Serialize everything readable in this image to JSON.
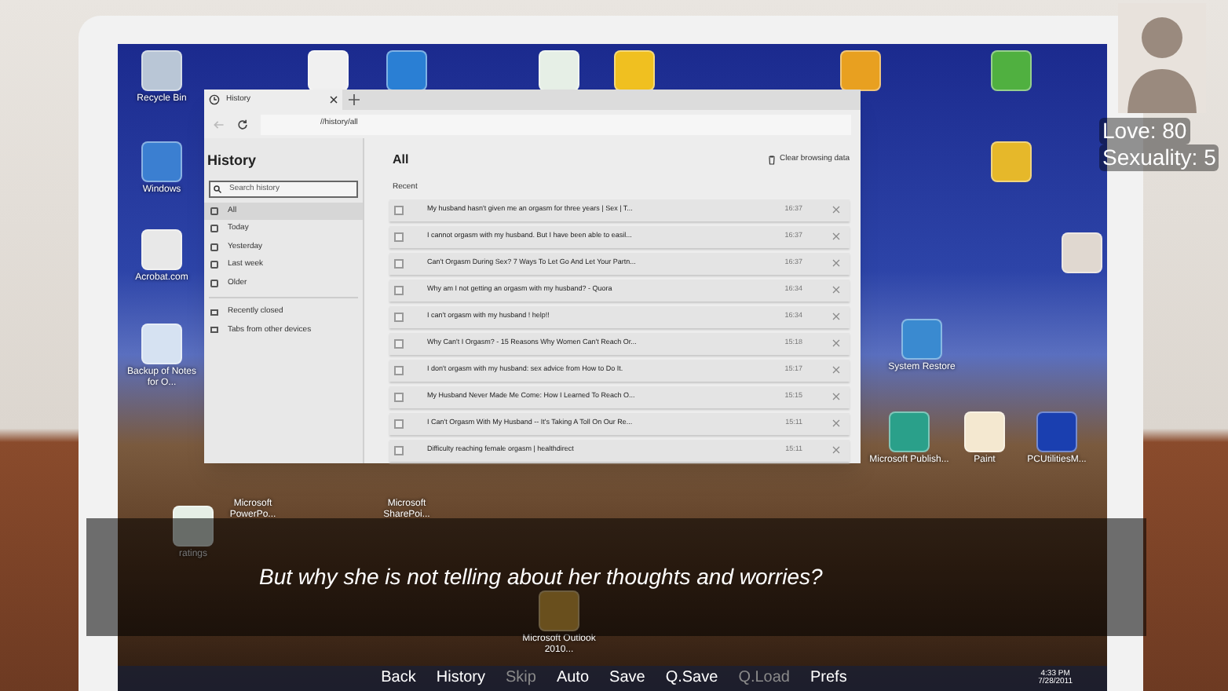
{
  "desktop_icons": [
    {
      "kind": "bin",
      "label": "Recycle Bin"
    },
    {
      "kind": "windows",
      "label": "Windows"
    },
    {
      "kind": "pdf",
      "label": "Acrobat.com"
    },
    {
      "kind": "word",
      "label": "Backup of Notes for O..."
    },
    {
      "kind": "note"
    },
    {
      "kind": "ie"
    },
    {
      "kind": "excel"
    },
    {
      "kind": "wave"
    },
    {
      "kind": "tools"
    },
    {
      "kind": "green"
    },
    {
      "kind": "globe"
    },
    {
      "kind": "person"
    },
    {
      "kind": "restore",
      "label": "System Restore"
    },
    {
      "kind": "publisher",
      "label": "Microsoft Publish..."
    },
    {
      "kind": "paint",
      "label": "Paint"
    },
    {
      "kind": "pcu",
      "label": "PCUtilitiesM..."
    },
    {
      "kind": "hidden",
      "label": "Microsoft PowerPo..."
    },
    {
      "kind": "hidden",
      "label": "Microsoft SharePoi..."
    },
    {
      "kind": "excel",
      "label": "ratings"
    },
    {
      "kind": "outlook",
      "label": "Microsoft Outlook 2010..."
    }
  ],
  "browser": {
    "tab_title": "History",
    "address": "//history/all",
    "sidebar_title": "History",
    "search_placeholder": "Search history",
    "nav": [
      {
        "label": "All",
        "selected": true
      },
      {
        "label": "Today",
        "selected": false
      },
      {
        "label": "Yesterday",
        "selected": false
      },
      {
        "label": "Last week",
        "selected": false
      },
      {
        "label": "Older",
        "selected": false
      }
    ],
    "other": [
      "Recently closed",
      "Tabs from other devices"
    ],
    "heading": "All",
    "clear_button": "Clear browsing data",
    "section": "Recent",
    "entries": [
      {
        "title": "My husband hasn't given me an orgasm for three years | Sex | T...",
        "time": "16:37",
        "checked": false
      },
      {
        "title": "I cannot orgasm with my husband. But I have been able to easil...",
        "time": "16:37",
        "checked": false
      },
      {
        "title": "Can't Orgasm During Sex? 7 Ways To Let Go And Let Your Partn...",
        "time": "16:37",
        "checked": false
      },
      {
        "title": "Why am I not getting an orgasm with my husband? - Quora",
        "time": "16:34",
        "checked": false
      },
      {
        "title": "I can't orgasm with my husband ! help!!",
        "time": "16:34",
        "checked": false
      },
      {
        "title": "Why Can't I Orgasm? - 15 Reasons Why Women Can't Reach Or...",
        "time": "15:18",
        "checked": false
      },
      {
        "title": "I don't orgasm with my husband: sex advice from How to Do It.",
        "time": "15:17",
        "checked": false
      },
      {
        "title": "My Husband Never Made Me Come: How I Learned To Reach O...",
        "time": "15:15",
        "checked": false
      },
      {
        "title": "I Can't Orgasm With My Husband -- It's Taking A Toll On Our Re...",
        "time": "15:11",
        "checked": false
      },
      {
        "title": "Difficulty reaching female orgasm | healthdirect",
        "time": "15:11",
        "checked": false
      }
    ]
  },
  "taskbar": {
    "time": "4:33 PM",
    "date": "7/28/2011"
  },
  "stats": [
    "Love: 80",
    "Sexuality: 5"
  ],
  "dialogue": "But why she is not telling about her thoughts and worries?",
  "quick_menu": [
    {
      "label": "Back",
      "disabled": false
    },
    {
      "label": "History",
      "disabled": false
    },
    {
      "label": "Skip",
      "disabled": true
    },
    {
      "label": "Auto",
      "disabled": false
    },
    {
      "label": "Save",
      "disabled": false
    },
    {
      "label": "Q.Save",
      "disabled": false
    },
    {
      "label": "Q.Load",
      "disabled": true
    },
    {
      "label": "Prefs",
      "disabled": false
    }
  ]
}
